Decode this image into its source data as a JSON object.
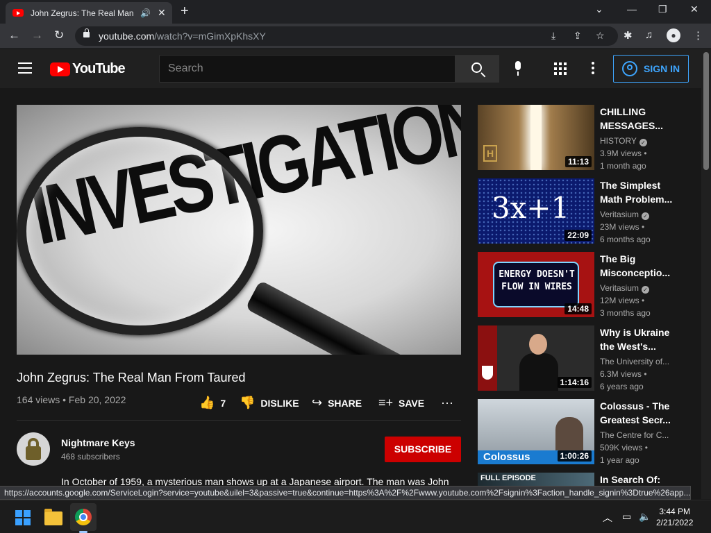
{
  "browser": {
    "tab_title": "John Zegrus: The Real Man From Taured - YouTube",
    "url_host": "youtube.com",
    "url_path": "/watch?v=mGimXpKhsXY",
    "status_url": "https://accounts.google.com/ServiceLogin?service=youtube&uilel=3&passive=true&continue=https%3A%2F%2Fwww.youtube.com%2Fsignin%3Faction_handle_signin%3Dtrue%26app..."
  },
  "masthead": {
    "logo_text": "YouTube",
    "search_placeholder": "Search",
    "signin_label": "SIGN IN"
  },
  "player": {
    "thumbnail_word": "INVESTIGATION"
  },
  "video": {
    "title": "John Zegrus: The Real Man From Taured",
    "meta": "164 views • Feb 20, 2022",
    "likes": "7",
    "dislike_label": "DISLIKE",
    "share_label": "SHARE",
    "save_label": "SAVE"
  },
  "channel": {
    "name": "Nightmare Keys",
    "subscribers": "468 subscribers",
    "subscribe_label": "SUBSCRIBE",
    "description": "In October of 1959, a mysterious man shows up at a Japanese airport. The man was John"
  },
  "recommendations": [
    {
      "title": "CHILLING MESSAGES...",
      "channel": "HISTORY",
      "verified": true,
      "views": "3.9M views •",
      "age": "1 month ago",
      "duration": "11:13"
    },
    {
      "title": "The Simplest Math Problem...",
      "channel": "Veritasium",
      "verified": true,
      "views": "23M views •",
      "age": "6 months ago",
      "duration": "22:09",
      "thumb_text": "3x+1"
    },
    {
      "title": "The Big Misconceptio...",
      "channel": "Veritasium",
      "verified": true,
      "views": "12M views •",
      "age": "3 months ago",
      "duration": "14:48",
      "thumb_text": "ENERGY DOESN'T FLOW IN WIRES"
    },
    {
      "title": "Why is Ukraine the West's...",
      "channel": "The University of...",
      "verified": false,
      "views": "6.3M views •",
      "age": "6 years ago",
      "duration": "1:14:16"
    },
    {
      "title": "Colossus - The Greatest Secr...",
      "channel": "The Centre for C...",
      "verified": false,
      "views": "509K views •",
      "age": "1 year ago",
      "duration": "1:00:26",
      "thumb_text": "Colossus"
    },
    {
      "title": "In Search Of:",
      "thumb_text": "FULL EPISODE"
    }
  ],
  "taskbar": {
    "time": "3:44 PM",
    "date": "2/21/2022"
  },
  "colors": {
    "yt_red": "#ff0000",
    "subscribe_red": "#cc0000",
    "signin_blue": "#3ea6ff",
    "background": "#181818"
  }
}
